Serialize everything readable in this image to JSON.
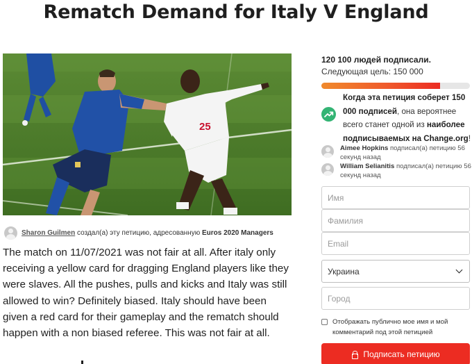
{
  "petition": {
    "title": "Rematch Demand for Italy V England",
    "image_alt": "Italy player pulling England player's shirt",
    "starter": {
      "name": "Sharon Guilmen",
      "action": "создал(а) эту петицию, адресованную",
      "target": "Euros 2020 Managers"
    },
    "body": "The match on 11/07/2021 was not fair at all. After italy only receiving a yellow card for dragging England players like they were slaves. All the pushes, pulls and kicks and Italy was still allowed to win? Definitely biased. Italy should have been given a red card for their gameplay and the rematch should happen with a non biased referee. This was not fair at all."
  },
  "sidebar": {
    "signature_count": "120 100 людей подписали.",
    "next_goal": "Следующая цель: 150 000",
    "progress_fraction": 0.8,
    "trend": {
      "part1": "Когда эта петиция соберет",
      "bold1": "150 000 подписей",
      "part2": ", она вероятнее всего станет одной из",
      "bold2": "наиболее подписываемых на Change.org",
      "part3": "!"
    },
    "recent_signers": [
      {
        "name": "Aimee Hopkins",
        "text": "подписал(а) петицию 56 секунд назад"
      },
      {
        "name": "William Selianitis",
        "text": "подписал(а) петицию 56 секунд назад"
      }
    ],
    "form": {
      "first_name_placeholder": "Имя",
      "last_name_placeholder": "Фамилия",
      "email_placeholder": "Email",
      "country_value": "Украина",
      "city_placeholder": "Город",
      "consent_label": "Отображать публично мое имя и мой комментарий под этой петицией",
      "submit_label": "Подписать петицию"
    }
  },
  "colors": {
    "accent_red": "#ec2c22",
    "trend_green": "#33b474"
  }
}
